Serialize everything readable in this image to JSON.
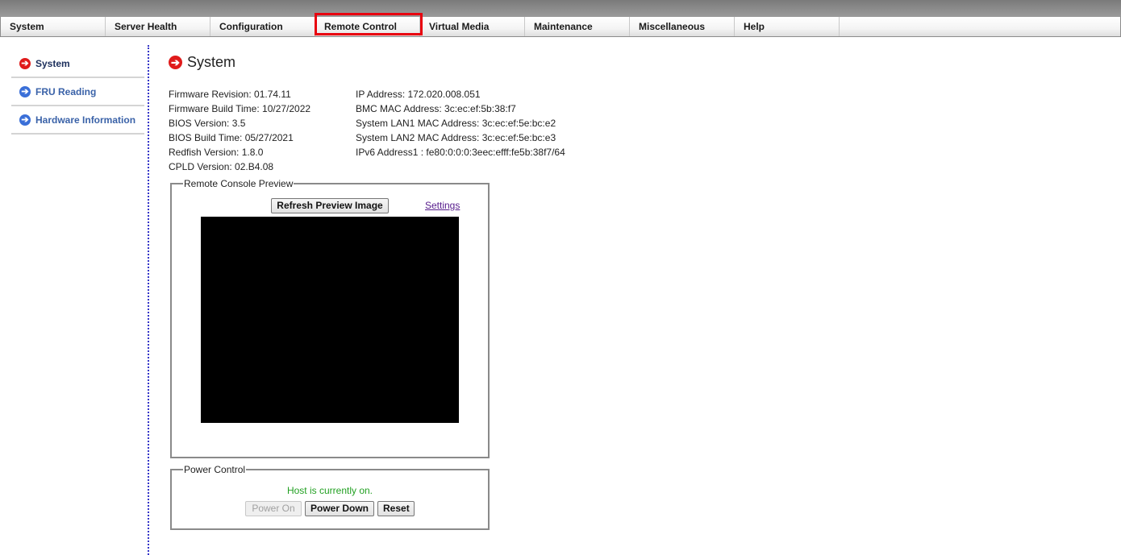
{
  "menubar": {
    "items": [
      {
        "label": "System"
      },
      {
        "label": "Server Health"
      },
      {
        "label": "Configuration"
      },
      {
        "label": "Remote Control",
        "highlighted": true
      },
      {
        "label": "Virtual Media"
      },
      {
        "label": "Maintenance"
      },
      {
        "label": "Miscellaneous"
      },
      {
        "label": "Help"
      }
    ]
  },
  "sidebar": {
    "items": [
      {
        "label": "System",
        "icon": "arrow-right-circle-icon",
        "active": true
      },
      {
        "label": "FRU Reading",
        "icon": "arrow-right-circle-icon"
      },
      {
        "label": "Hardware Information",
        "icon": "arrow-right-circle-icon"
      }
    ]
  },
  "page": {
    "title": "System",
    "icon": "arrow-right-circle-icon"
  },
  "info_left": [
    "Firmware Revision:  01.74.11",
    "Firmware Build Time:  10/27/2022",
    "BIOS Version: 3.5",
    "BIOS Build Time: 05/27/2021",
    "Redfish Version: 1.8.0",
    "CPLD Version: 02.B4.08"
  ],
  "info_right": [
    "IP Address:  172.020.008.051",
    "BMC MAC Address:  3c:ec:ef:5b:38:f7",
    "System LAN1 MAC Address: 3c:ec:ef:5e:bc:e2",
    "System LAN2 MAC Address: 3c:ec:ef:5e:bc:e3",
    "IPv6 Address1 : fe80:0:0:0:3eec:efff:fe5b:38f7/64"
  ],
  "preview": {
    "legend": "Remote Console Preview",
    "refresh_label": "Refresh Preview Image",
    "settings_label": "Settings"
  },
  "power": {
    "legend": "Power Control",
    "status": "Host is currently on.",
    "status_color": "#22a022",
    "power_on_label": "Power On",
    "power_down_label": "Power Down",
    "reset_label": "Reset"
  }
}
